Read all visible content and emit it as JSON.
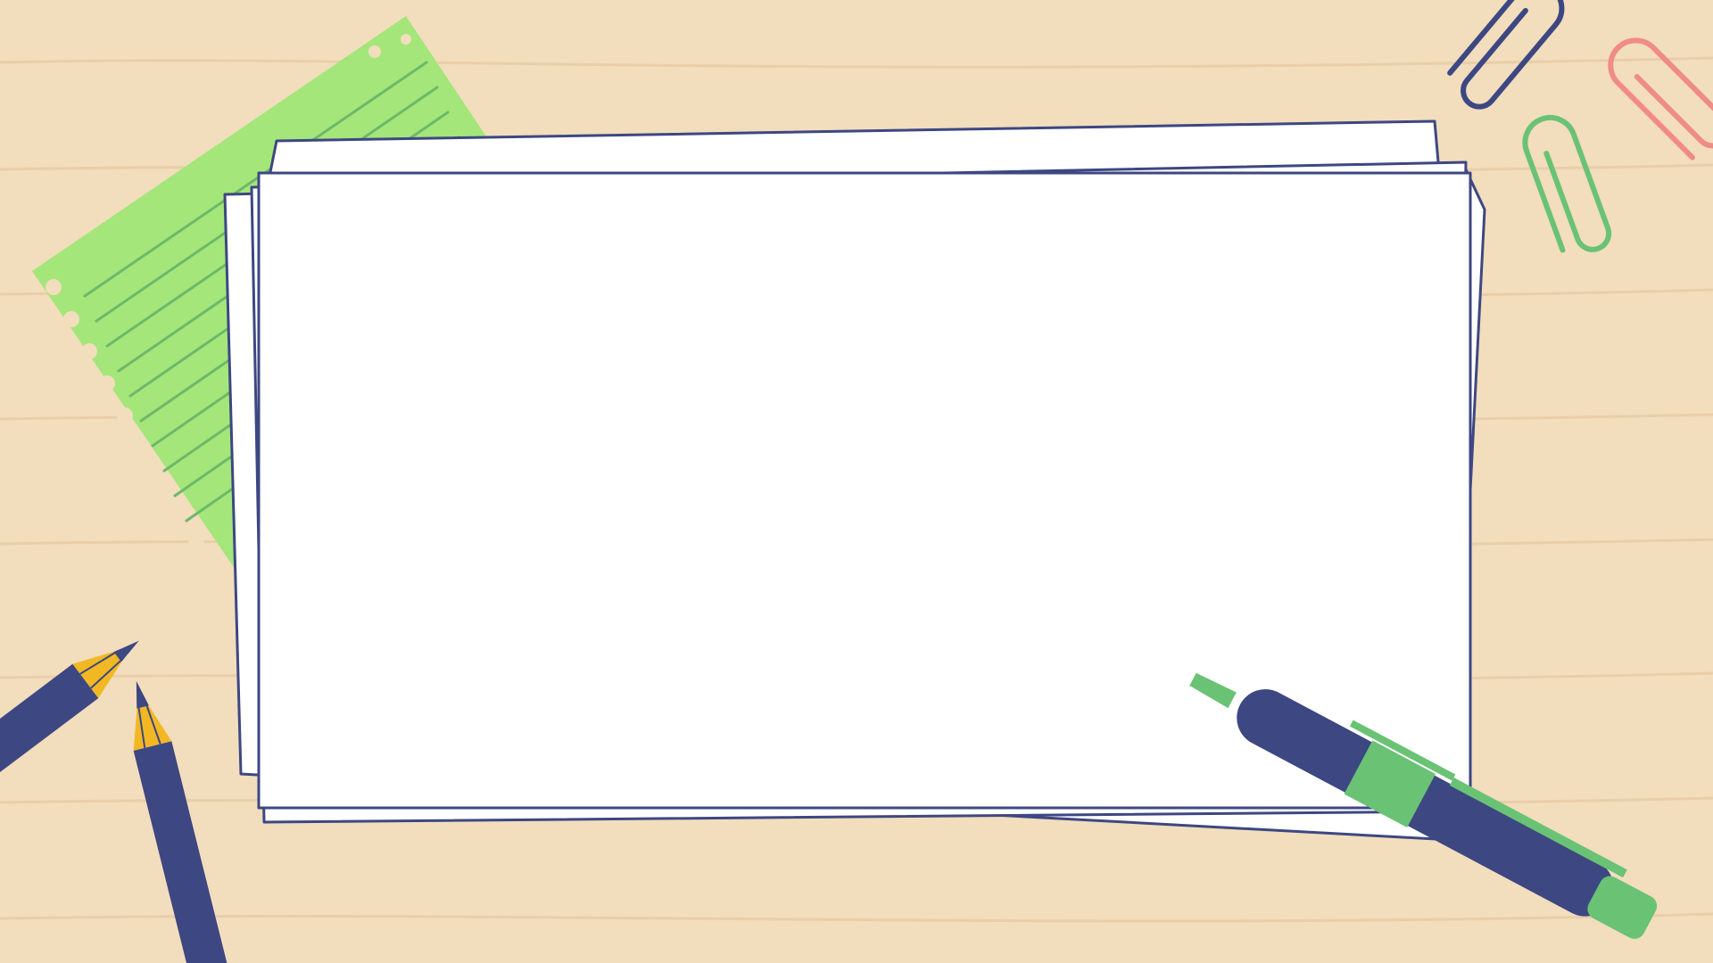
{
  "scene": {
    "colors": {
      "desk_wood": "#F2DDBD",
      "wood_grain": "#E6CBA2",
      "paper": "#FFFFFF",
      "outline_navy": "#3D4782",
      "notepad_green": "#A4E67A",
      "notepad_line": "#6EB86A",
      "pen_body": "#3D4782",
      "pen_accent": "#6AC275",
      "pencil_body": "#3D4782",
      "pencil_wood": "#F2B824",
      "clip_navy": "#3D4782",
      "clip_green": "#6AC275",
      "clip_red": "#F08C86"
    },
    "icons": [
      "green-lined-notepad",
      "blank-paper-stack",
      "paperclip",
      "pen",
      "pencil"
    ]
  }
}
